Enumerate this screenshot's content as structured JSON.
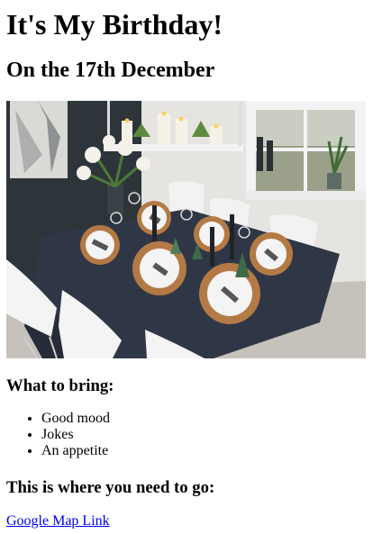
{
  "page": {
    "title": "It's My Birthday!",
    "subtitle": "On the 17th December"
  },
  "photo": {
    "description_icon": "dining-table-photo"
  },
  "bring": {
    "heading": "What to bring:",
    "items": [
      "Good mood",
      "Jokes",
      "An appetite"
    ]
  },
  "location": {
    "heading": "This is where you need to go:",
    "link_label": "Google Map Link"
  },
  "colors": {
    "link": "#0000ee",
    "tablecloth": "#2f3746",
    "wall": "#2b3338",
    "floor": "#c9c4bd"
  }
}
